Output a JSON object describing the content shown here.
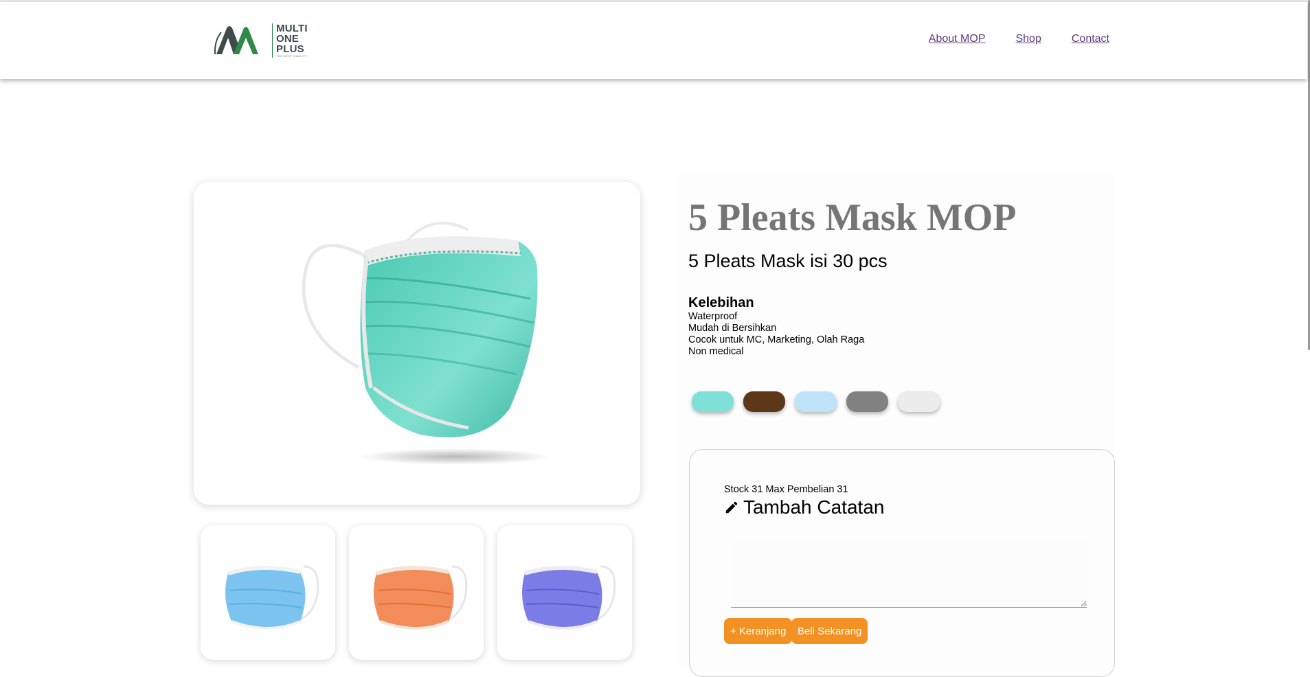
{
  "header": {
    "logo": {
      "line1": "MULTI",
      "line2": "ONE",
      "line3": "PLUS",
      "tagline": "THE BEST QUALITY"
    },
    "nav": [
      {
        "label": "About MOP"
      },
      {
        "label": "Shop"
      },
      {
        "label": "Contact"
      }
    ]
  },
  "product": {
    "title": "5 Pleats Mask MOP",
    "subtitle": "5 Pleats Mask isi 30 pcs",
    "features_title": "Kelebihan",
    "features": [
      "Waterproof",
      "Mudah di Bersihkan",
      "Cocok untuk MC, Marketing, Olah Raga",
      "Non medical"
    ],
    "main_image": "teal-mask-image",
    "thumbnails": [
      {
        "color_name": "light-blue-mask",
        "color": "#7cc4ef"
      },
      {
        "color_name": "orange-mask",
        "color": "#f28d5a"
      },
      {
        "color_name": "purple-blue-mask",
        "color": "#7c7ce6"
      }
    ],
    "color_options": [
      {
        "color": "#7fe0d7"
      },
      {
        "color": "#5c3818"
      },
      {
        "color": "#bfe4fa"
      },
      {
        "color": "#818181"
      },
      {
        "color": "#ececec"
      }
    ]
  },
  "purchase": {
    "stock_text": "Stock 31 Max Pembelian 31",
    "note_title": "Tambah Catatan",
    "note_value": "",
    "add_to_cart": "+ Keranjang",
    "buy_now": "Beli Sekarang"
  },
  "colors": {
    "accent": "#f39222",
    "title_gray": "#757575",
    "link": "#5a3b7e"
  }
}
